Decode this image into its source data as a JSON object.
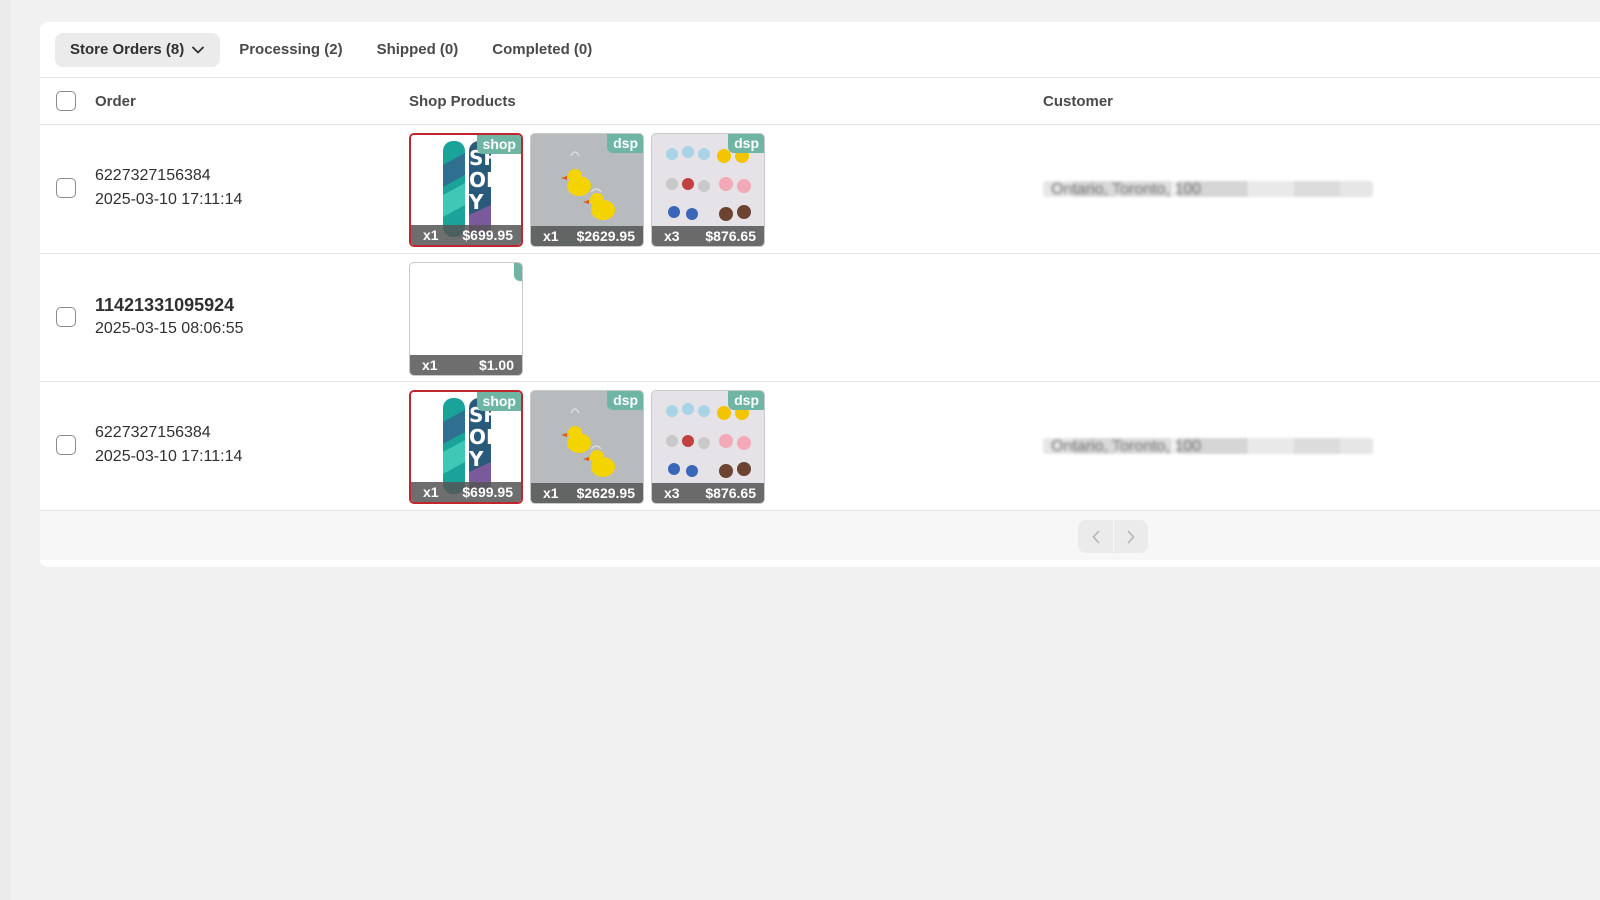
{
  "tabs": [
    {
      "label": "Store Orders (8)",
      "active": true
    },
    {
      "label": "Processing (2)",
      "active": false
    },
    {
      "label": "Shipped (0)",
      "active": false
    },
    {
      "label": "Completed (0)",
      "active": false
    }
  ],
  "table": {
    "headers": {
      "order": "Order",
      "products": "Shop Products",
      "customer": "Customer"
    }
  },
  "rows": [
    {
      "order_id": "6227327156384",
      "date": "2025-03-10 17:11:14",
      "products": [
        {
          "badge": "shop",
          "qty": "x1",
          "price": "$699.95",
          "image": "snowboard"
        },
        {
          "badge": "dsp",
          "qty": "x1",
          "price": "$2629.95",
          "image": "duck-earrings"
        },
        {
          "badge": "dsp",
          "qty": "x3",
          "price": "$876.65",
          "image": "animal-charms"
        }
      ],
      "customer": "Ontario, Toronto, 100"
    },
    {
      "order_id": "11421331095924",
      "date": "2025-03-15 08:06:55",
      "products": [
        {
          "badge": "",
          "qty": "x1",
          "price": "$1.00",
          "image": "blank"
        }
      ],
      "customer": ""
    },
    {
      "order_id": "6227327156384",
      "date": "2025-03-10 17:11:14",
      "products": [
        {
          "badge": "shop",
          "qty": "x1",
          "price": "$699.95",
          "image": "snowboard"
        },
        {
          "badge": "dsp",
          "qty": "x1",
          "price": "$2629.95",
          "image": "duck-earrings"
        },
        {
          "badge": "dsp",
          "qty": "x3",
          "price": "$876.65",
          "image": "animal-charms"
        }
      ],
      "customer": "Ontario, Toronto, 100"
    }
  ],
  "pagination": {
    "prev_icon": "chevron-left-icon",
    "next_icon": "chevron-right-icon"
  },
  "colors": {
    "badge": "#6eb5a3",
    "selected_border": "#c0262d",
    "tab_active_bg": "#ebebeb"
  }
}
